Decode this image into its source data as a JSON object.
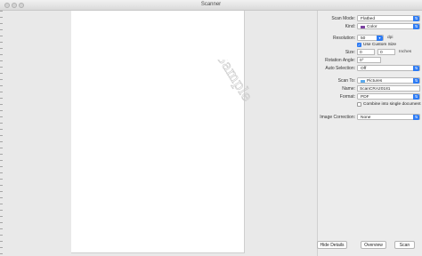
{
  "window": {
    "title": "Scanner"
  },
  "settings": {
    "scan_mode": {
      "label": "Scan Mode:",
      "value": "Flatbed"
    },
    "kind": {
      "label": "Kind:",
      "value": "Color",
      "swatch_color": "#7a3fa0"
    },
    "resolution": {
      "label": "Resolution:",
      "value": "50",
      "unit": "dpi"
    },
    "use_custom_size": {
      "label": "Use Custom Size",
      "checked": true
    },
    "size": {
      "label": "Size:",
      "width": "0",
      "height": "0",
      "unit": "Inches"
    },
    "rotation_angle": {
      "label": "Rotation Angle:",
      "value": "0°"
    },
    "auto_selection": {
      "label": "Auto Selection:",
      "value": "Off"
    },
    "scan_to": {
      "label": "Scan To:",
      "value": "Pictures"
    },
    "name": {
      "label": "Name:",
      "value": "ScanCRA20181"
    },
    "format": {
      "label": "Format:",
      "value": "PDF"
    },
    "combine": {
      "label": "Combine into single document",
      "checked": false
    },
    "image_correction": {
      "label": "Image Correction:",
      "value": "None"
    }
  },
  "buttons": {
    "hide_details": "Hide Details",
    "overview": "Overview",
    "scan": "Scan"
  },
  "preview": {
    "watermark": "Sample"
  },
  "colors": {
    "accent": "#2d7bf4"
  }
}
